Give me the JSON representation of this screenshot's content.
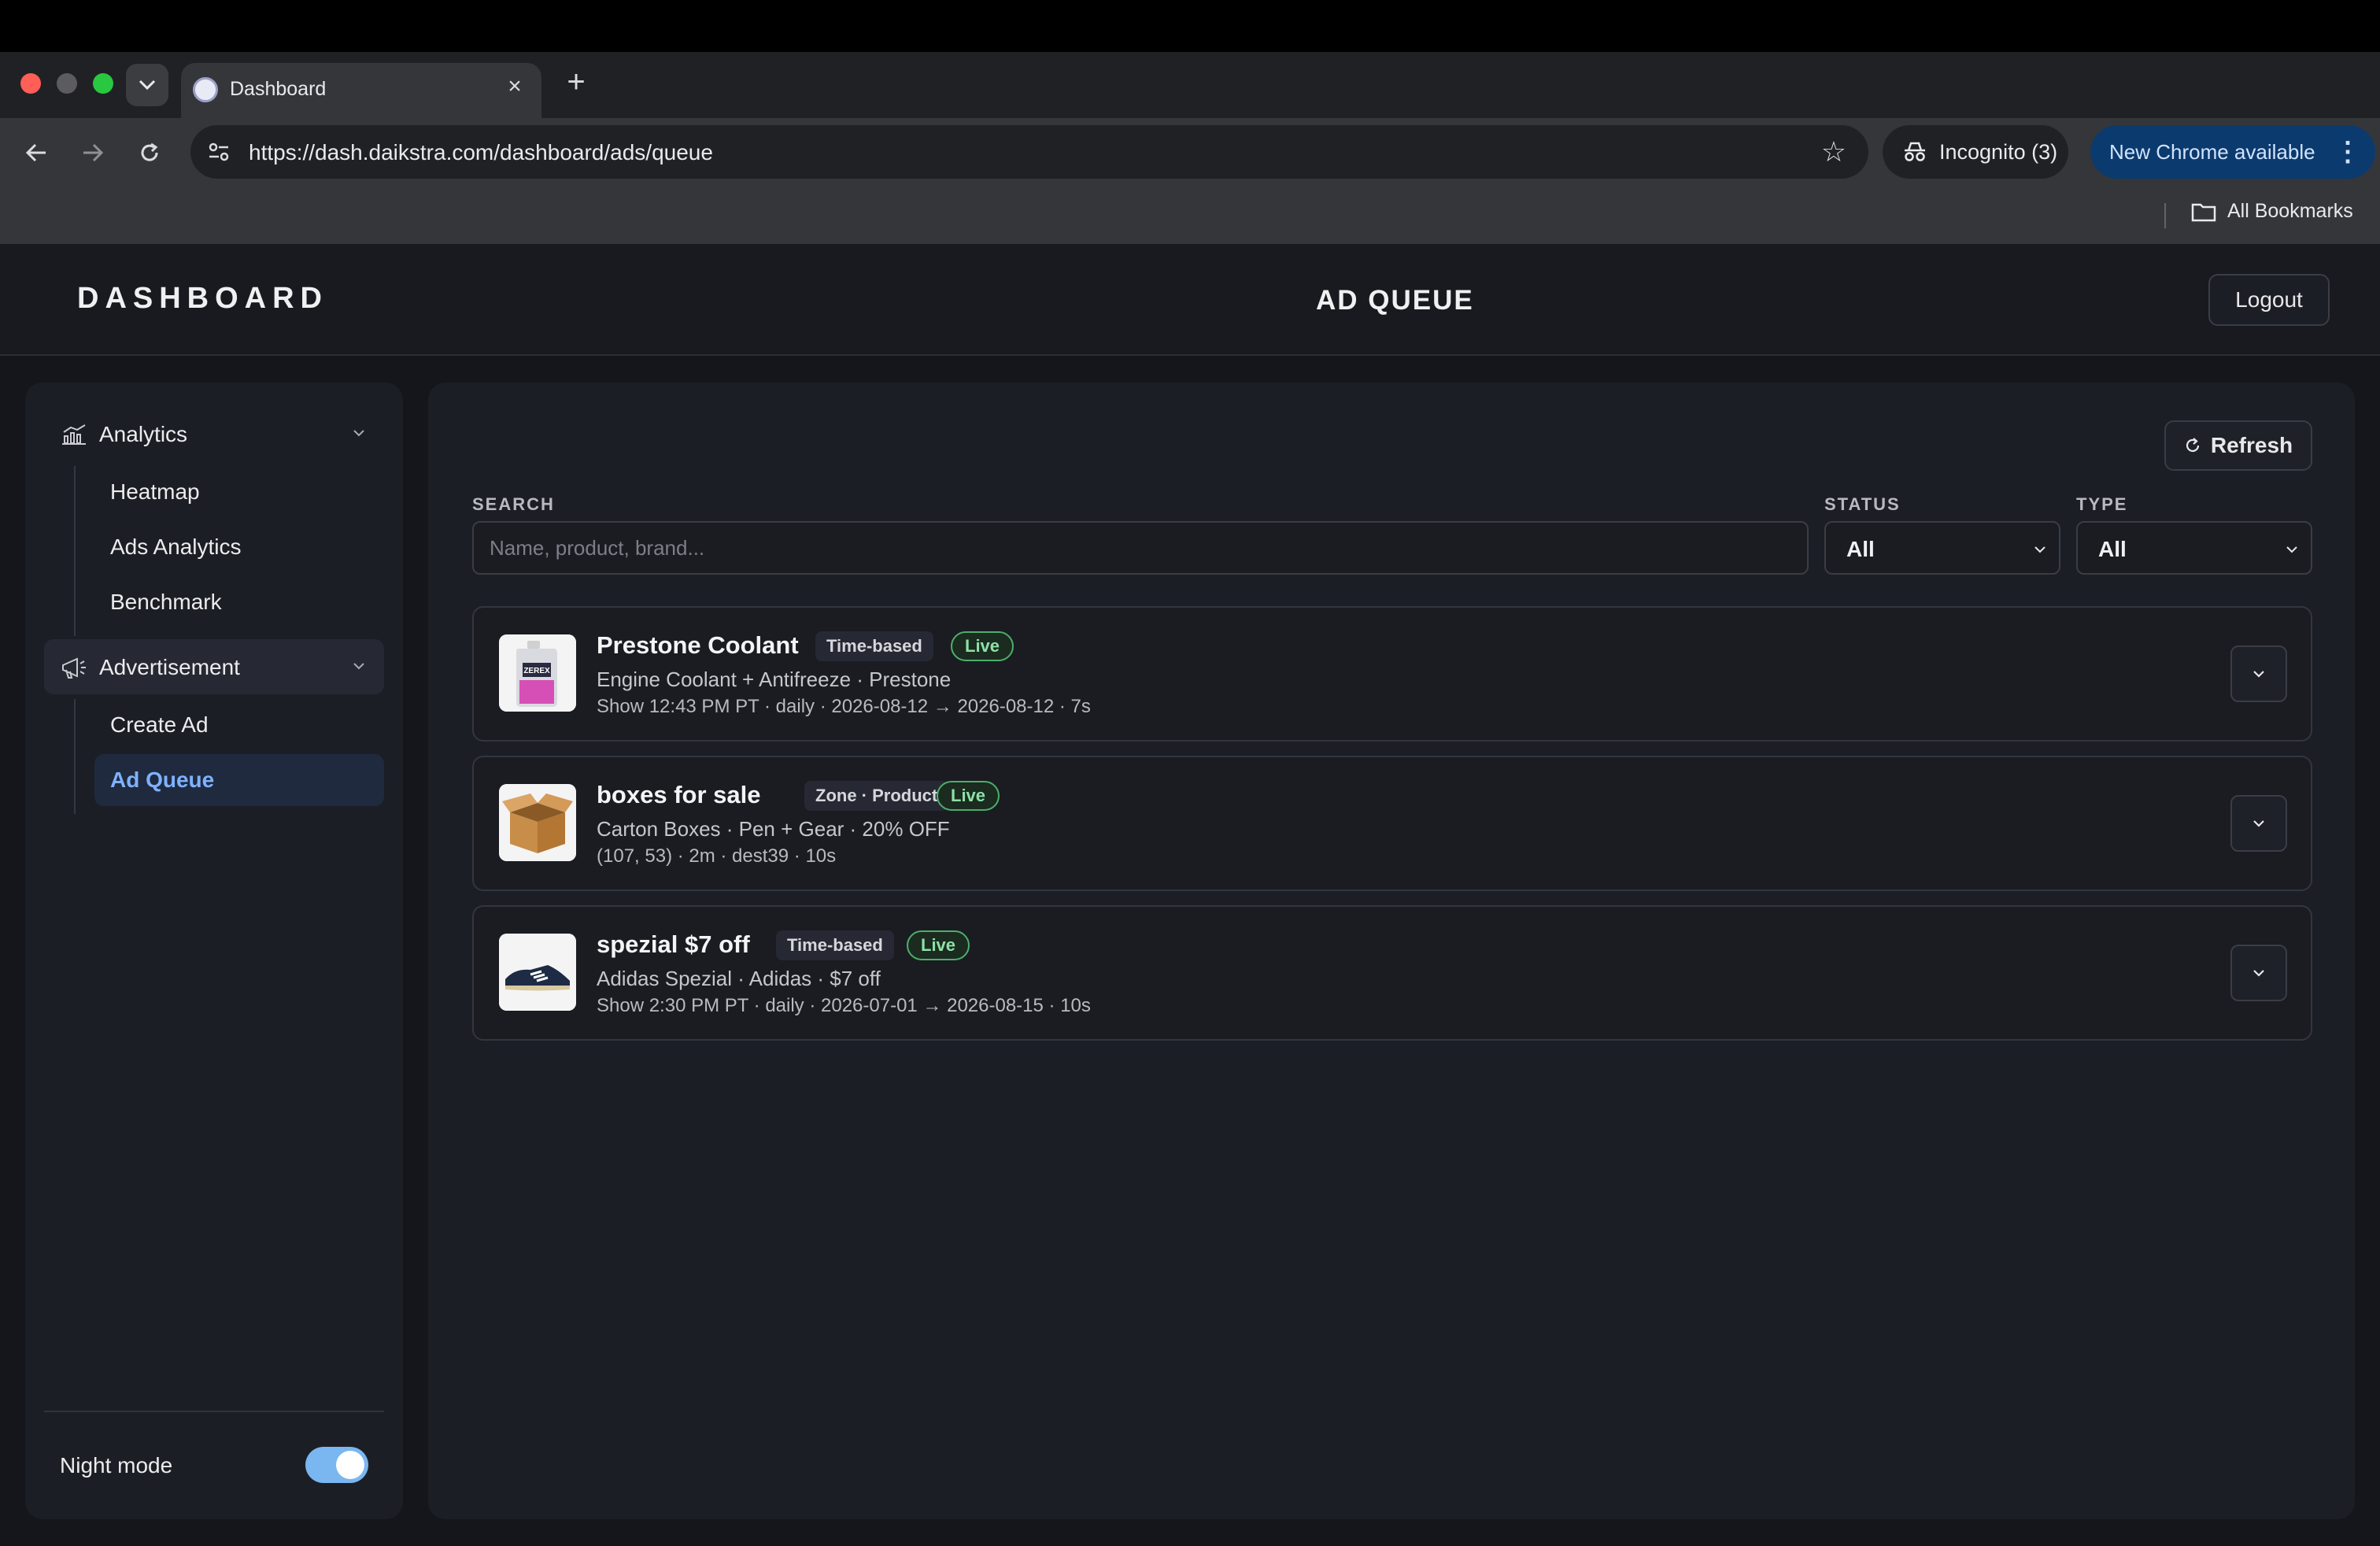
{
  "browser": {
    "tab_title": "Dashboard",
    "url": "https://dash.daikstra.com/dashboard/ads/queue",
    "incognito_label": "Incognito (3)",
    "update_label": "New Chrome available",
    "bookmarks_label": "All Bookmarks"
  },
  "header": {
    "brand": "DASHBOARD",
    "title": "AD QUEUE",
    "logout_label": "Logout"
  },
  "sidebar": {
    "groups": [
      {
        "label": "Analytics",
        "icon": "chart-icon",
        "items": [
          "Heatmap",
          "Ads Analytics",
          "Benchmark"
        ]
      },
      {
        "label": "Advertisement",
        "icon": "megaphone-icon",
        "items": [
          "Create Ad",
          "Ad Queue"
        ]
      }
    ],
    "active_item": "Ad Queue",
    "night_mode_label": "Night mode",
    "night_mode_on": true
  },
  "toolbar": {
    "refresh_label": "Refresh"
  },
  "filters": {
    "search_label": "SEARCH",
    "search_placeholder": "Name, product, brand...",
    "search_value": "",
    "status_label": "STATUS",
    "status_value": "All",
    "type_label": "TYPE",
    "type_value": "All"
  },
  "ads": [
    {
      "name": "Prestone Coolant",
      "type": "Time-based",
      "status": "Live",
      "subtitle": "Engine Coolant + Antifreeze · Prestone",
      "meta": "Show 12:43 PM PT · daily · 2026-08-12 → 2026-08-12 · 7s",
      "thumb_label": "ZEREX"
    },
    {
      "name": "boxes for sale",
      "type": "Zone · Product",
      "status": "Live",
      "subtitle": "Carton Boxes · Pen + Gear · 20% OFF",
      "meta": "(107, 53) · 2m · dest39 · 10s"
    },
    {
      "name": "spezial $7 off",
      "type": "Time-based",
      "status": "Live",
      "subtitle": "Adidas Spezial · Adidas · $7 off",
      "meta": "Show 2:30 PM PT · daily · 2026-07-01 → 2026-08-15 · 10s"
    }
  ],
  "colors": {
    "accent": "#7fb1ff",
    "live": "#4caf6a",
    "toggle": "#7ab6f0"
  }
}
